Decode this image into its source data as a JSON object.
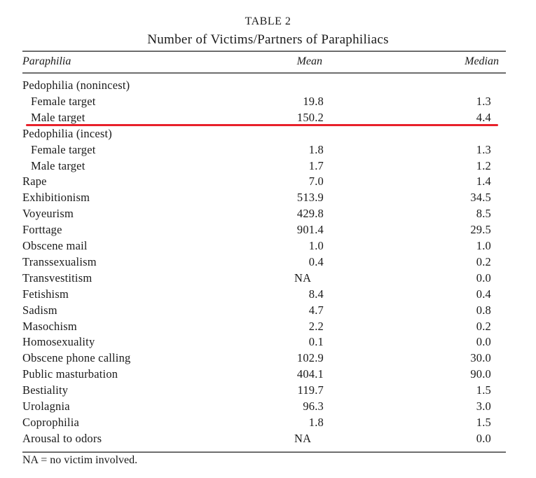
{
  "title": "TABLE 2",
  "subtitle": "Number of Victims/Partners of Paraphiliacs",
  "columns": {
    "paraphilia": "Paraphilia",
    "mean": "Mean",
    "median": "Median"
  },
  "rows": [
    {
      "label": "Pedophilia (nonincest)",
      "mean": "",
      "median": "",
      "indent": false
    },
    {
      "label": "Female target",
      "mean": "19.8",
      "median": "1.3",
      "indent": true
    },
    {
      "label": "Male target",
      "mean": "150.2",
      "median": "4.4",
      "indent": true
    },
    {
      "label": "Pedophilia (incest)",
      "mean": "",
      "median": "",
      "indent": false
    },
    {
      "label": "Female target",
      "mean": "1.8",
      "median": "1.3",
      "indent": true
    },
    {
      "label": "Male target",
      "mean": "1.7",
      "median": "1.2",
      "indent": true
    },
    {
      "label": "Rape",
      "mean": "7.0",
      "median": "1.4",
      "indent": false
    },
    {
      "label": "Exhibitionism",
      "mean": "513.9",
      "median": "34.5",
      "indent": false
    },
    {
      "label": "Voyeurism",
      "mean": "429.8",
      "median": "8.5",
      "indent": false
    },
    {
      "label": "Forttage",
      "mean": "901.4",
      "median": "29.5",
      "indent": false
    },
    {
      "label": "Obscene mail",
      "mean": "1.0",
      "median": "1.0",
      "indent": false
    },
    {
      "label": "Transsexualism",
      "mean": "0.4",
      "median": "0.2",
      "indent": false
    },
    {
      "label": "Transvestitism",
      "mean": "NA",
      "median": "0.0",
      "indent": false
    },
    {
      "label": "Fetishism",
      "mean": "8.4",
      "median": "0.4",
      "indent": false
    },
    {
      "label": "Sadism",
      "mean": "4.7",
      "median": "0.8",
      "indent": false
    },
    {
      "label": "Masochism",
      "mean": "2.2",
      "median": "0.2",
      "indent": false
    },
    {
      "label": "Homosexuality",
      "mean": "0.1",
      "median": "0.0",
      "indent": false
    },
    {
      "label": "Obscene phone calling",
      "mean": "102.9",
      "median": "30.0",
      "indent": false
    },
    {
      "label": "Public masturbation",
      "mean": "404.1",
      "median": "90.0",
      "indent": false
    },
    {
      "label": "Bestiality",
      "mean": "119.7",
      "median": "1.5",
      "indent": false
    },
    {
      "label": "Urolagnia",
      "mean": "96.3",
      "median": "3.0",
      "indent": false
    },
    {
      "label": "Coprophilia",
      "mean": "1.8",
      "median": "1.5",
      "indent": false
    },
    {
      "label": "Arousal to odors",
      "mean": "NA",
      "median": "0.0",
      "indent": false
    }
  ],
  "footnote": "NA = no victim involved.",
  "annotation": {
    "type": "red underline",
    "under_row": "Male target (Pedophilia nonincest)",
    "color": "#e8212b"
  }
}
